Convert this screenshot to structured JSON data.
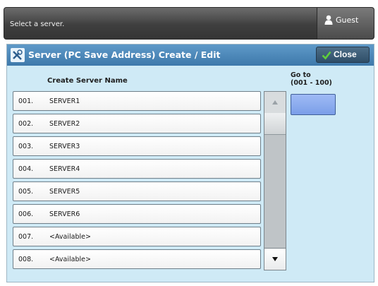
{
  "header": {
    "message": "Select a server.",
    "user_label": "Guest"
  },
  "panel": {
    "title": "Server (PC Save Address) Create / Edit",
    "close_label": "Close",
    "column_header": "Create Server Name",
    "goto": {
      "label": "Go to",
      "range": "(001 - 100)",
      "value": ""
    }
  },
  "servers": [
    {
      "num": "001.",
      "name": "SERVER1"
    },
    {
      "num": "002.",
      "name": "SERVER2"
    },
    {
      "num": "003.",
      "name": "SERVER3"
    },
    {
      "num": "004.",
      "name": "SERVER4"
    },
    {
      "num": "005.",
      "name": "SERVER5"
    },
    {
      "num": "006.",
      "name": "SERVER6"
    },
    {
      "num": "007.",
      "name": "<Available>"
    },
    {
      "num": "008.",
      "name": "<Available>"
    }
  ],
  "icons": {
    "user": "user-icon",
    "tools": "tools-icon",
    "check": "check-icon",
    "scroll_up": "chevron-up-icon",
    "scroll_down": "chevron-down-icon"
  }
}
